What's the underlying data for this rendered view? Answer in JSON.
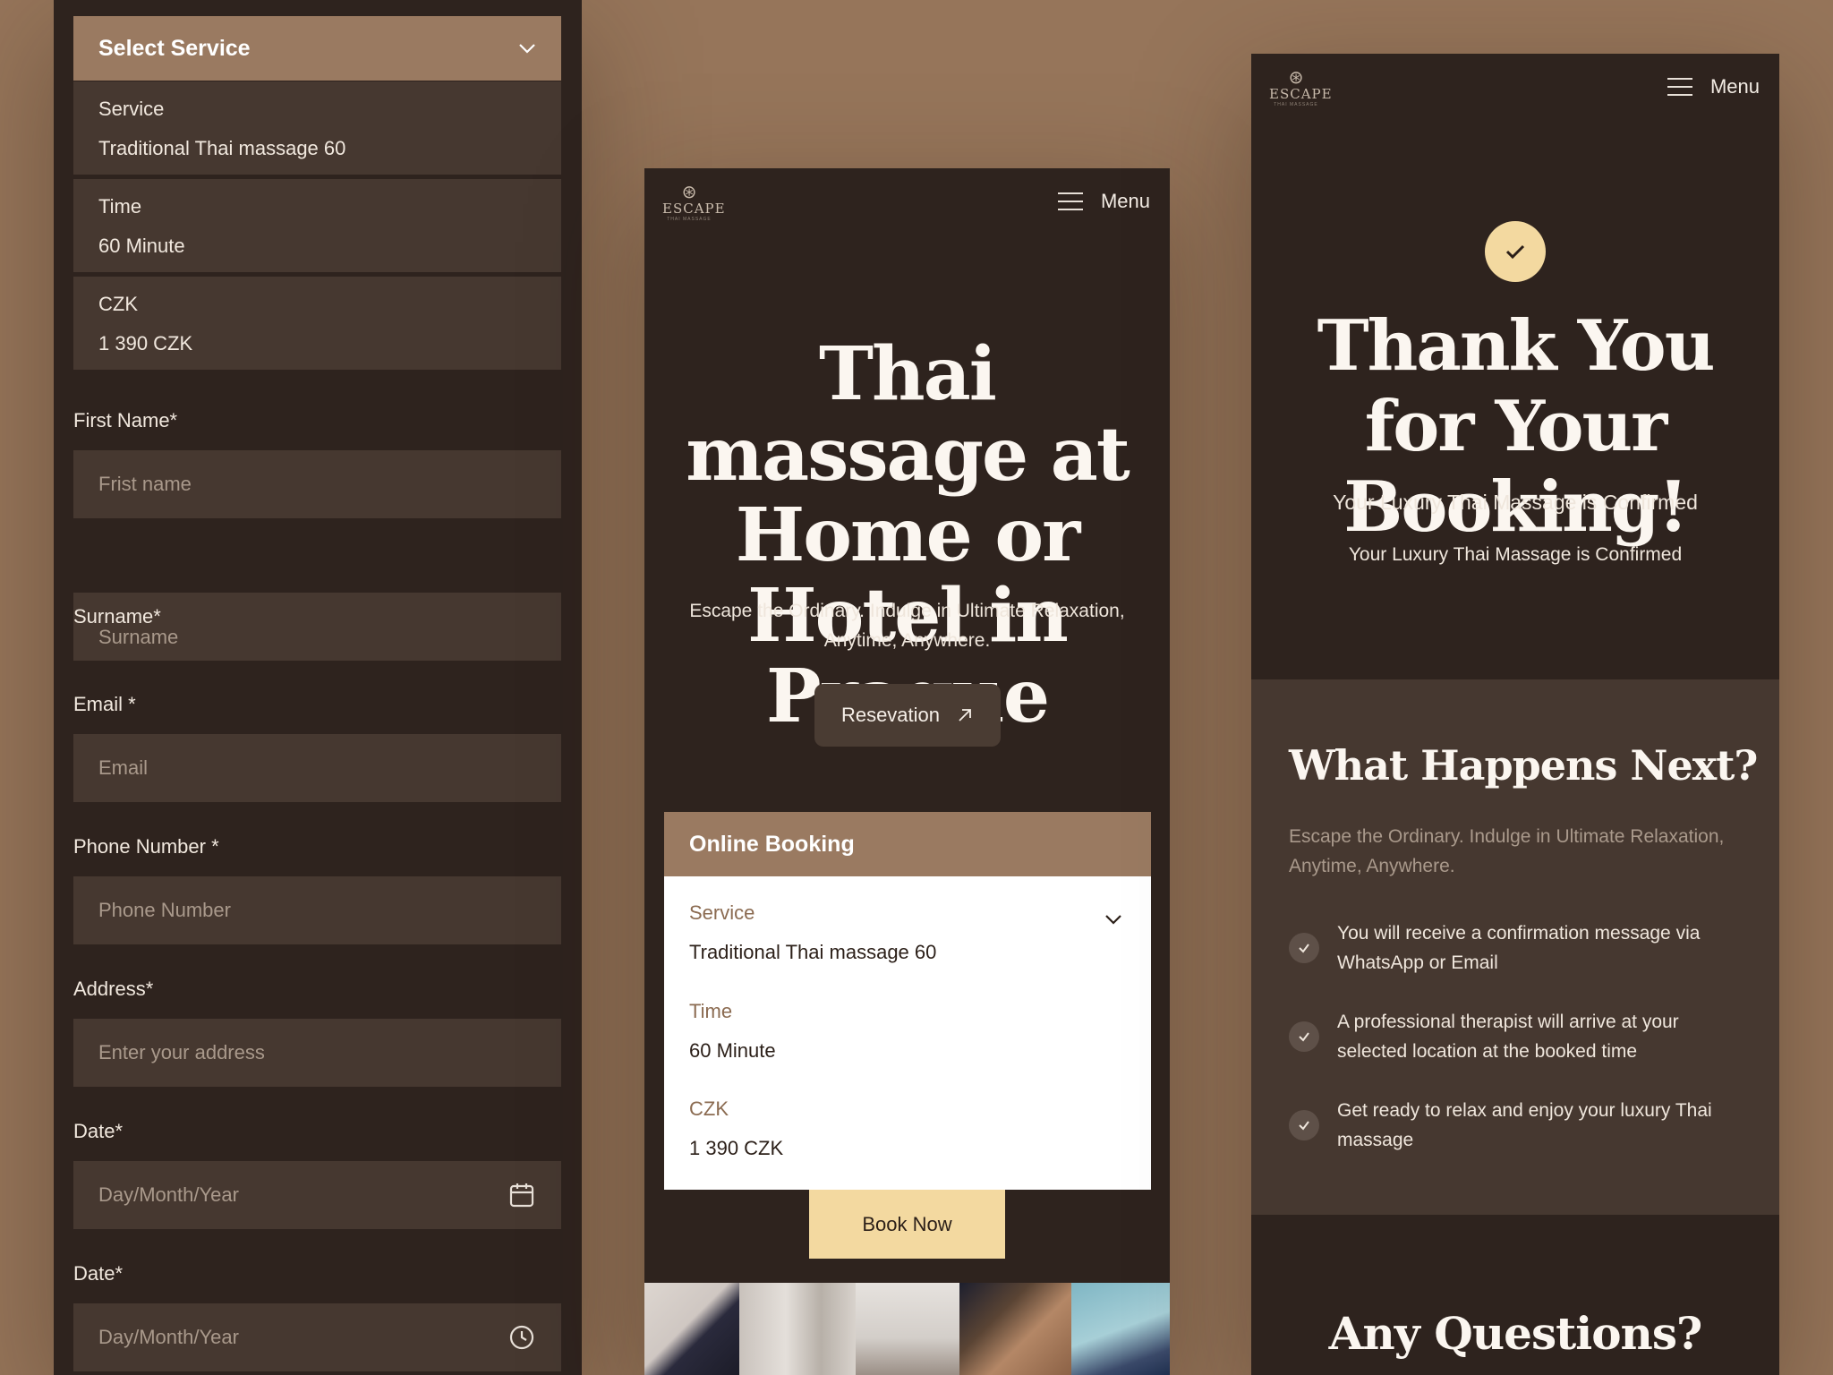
{
  "left_form": {
    "select_title": "Select Service",
    "summary": [
      {
        "label": "Service",
        "value": "Traditional Thai massage 60"
      },
      {
        "label": "Time",
        "value": "60 Minute"
      },
      {
        "label": "CZK",
        "value": "1 390 CZK"
      }
    ],
    "fields": {
      "first_name": {
        "label": "First Name*",
        "placeholder": "Frist name"
      },
      "surname": {
        "label": "Surname*",
        "placeholder": "Surname"
      },
      "email": {
        "label": "Email *",
        "placeholder": "Email"
      },
      "phone": {
        "label": "Phone Number *",
        "placeholder": "Phone Number"
      },
      "address": {
        "label": "Address*",
        "placeholder": "Enter your address"
      },
      "date": {
        "label": "Date*",
        "placeholder": "Day/Month/Year",
        "icon": "calendar-icon"
      },
      "time": {
        "label": "Date*",
        "placeholder": "Day/Month/Year",
        "icon": "clock-icon"
      }
    }
  },
  "middle": {
    "logo": {
      "word": "ESCAPE",
      "tagline": "THAI MASSAGE"
    },
    "menu_label": "Menu",
    "hero_title": "Thai massage at Home or Hotel in Prague",
    "hero_subtitle": "Escape the Ordinary. Indulge in Ultimate Relaxation, Anytime, Anywhere.",
    "reservation_label": "Resevation",
    "online_booking_title": "Online Booking",
    "booking": [
      {
        "label": "Service",
        "value": "Traditional Thai massage 60"
      },
      {
        "label": "Time",
        "value": "60 Minute"
      },
      {
        "label": "CZK",
        "value": "1 390 CZK"
      }
    ],
    "book_now_label": "Book Now"
  },
  "right": {
    "logo": {
      "word": "ESCAPE",
      "tagline": "THAI MASSAGE"
    },
    "menu_label": "Menu",
    "thank_you_title": "Thank You for Your Booking!",
    "confirmed_line_1": "Your Luxury Thai Massage is Confirmed",
    "confirmed_line_2": "Your Luxury Thai Massage is Confirmed",
    "next_title": "What Happens Next?",
    "next_subtitle": "Escape the Ordinary. Indulge in Ultimate Relaxation, Anytime, Anywhere.",
    "steps": [
      "You will receive a confirmation message via WhatsApp or Email",
      "A professional therapist will arrive at your selected location at the booked time",
      "Get ready to relax and enjoy your luxury Thai massage"
    ],
    "questions_title": "Any Questions?"
  },
  "colors": {
    "background": "#96755a",
    "panel_dark": "#2e231e",
    "panel_field": "#463830",
    "accent_brown": "#9a7a61",
    "accent_cream": "#f3d9a0"
  }
}
